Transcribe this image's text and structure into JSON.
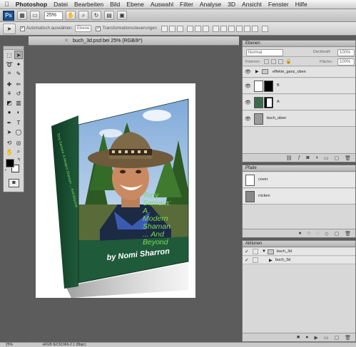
{
  "menubar": {
    "apple": "",
    "items": [
      "Photoshop",
      "Datei",
      "Bearbeiten",
      "Bild",
      "Ebene",
      "Auswahl",
      "Filter",
      "Analyse",
      "3D",
      "Ansicht",
      "Fenster",
      "Hilfe"
    ]
  },
  "appbar": {
    "badge": "Ps",
    "zoom": "25%"
  },
  "options": {
    "autoselect_label": "Automatisch auswählen:",
    "autoselect_value": "Ebene",
    "transform_label": "Transformationssteuerungen"
  },
  "document": {
    "tab_title": "buch_3d.psd bei 25% (RGB/8*)",
    "book": {
      "title_lines": [
        "Tony",
        "Samara:",
        "A",
        "Modern",
        "Shaman",
        "... And",
        "Beyond"
      ],
      "author": "by Nomi Sharron",
      "spine_text": "Tony Samara: A Modern Shaman ... And Beyond"
    }
  },
  "panels": {
    "layers": {
      "tabs": [
        "Ebenen"
      ],
      "blend_mode": "Normal",
      "opacity_label": "Deckkraft:",
      "opacity_value": "100%",
      "lock_label": "Fixieren:",
      "fill_label": "Fläche:",
      "fill_value": "100%",
      "rows": [
        {
          "name": "effekte_ganz_oben",
          "type": "group"
        },
        {
          "name": "B",
          "type": "mask-layer"
        },
        {
          "name": "A",
          "type": "mask-layer"
        },
        {
          "name": "buch_oben",
          "type": "layer"
        }
      ]
    },
    "paths": {
      "tabs": [
        "Pfade"
      ],
      "rows": [
        {
          "name": "cover"
        },
        {
          "name": "rücken"
        }
      ]
    },
    "actions": {
      "tabs": [
        "Aktionen"
      ],
      "rows": [
        {
          "name": "buch_3d",
          "checked": true
        },
        {
          "name": "buch_3d",
          "checked": true
        }
      ]
    }
  },
  "status": {
    "zoom": "25%",
    "info": "sRGB IEC61966-2.1 (8bpc)"
  },
  "colors": {
    "ps_blue": "#1c4f8c",
    "book_green": "#1f5a3a",
    "title_green": "#7ed957"
  }
}
